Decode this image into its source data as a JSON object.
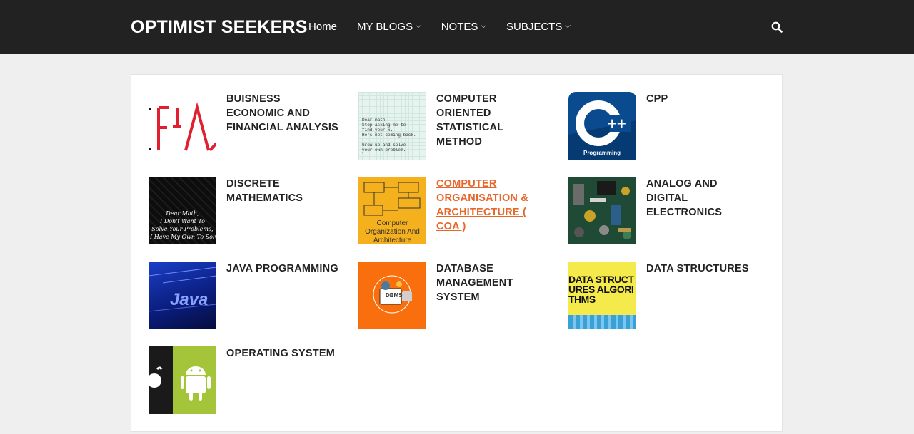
{
  "brand": "OPTIMIST SEEKERS",
  "nav": {
    "home": "Home",
    "blogs": "MY BLOGS",
    "notes": "NOTES",
    "subjects": "SUBJECTS"
  },
  "subjects": [
    {
      "title": "BUISNESS ECONOMIC AND FINANCIAL ANALYSIS",
      "thumb_text": "FA"
    },
    {
      "title": "COMPUTER ORIENTED STATISTICAL METHOD",
      "thumb_text": "Dear math\nStop asking me to\nfind your x.\nHe's not coming back.\n\nGrow up and solve\nyour own problem."
    },
    {
      "title": "CPP",
      "thumb_text": "Programming",
      "thumb_sub": "++"
    },
    {
      "title": "DISCRETE MATHEMATICS",
      "thumb_text": "Dear Math,\nI Don't Want To\nSolve Your Problems,\nI Have My Own To Solve"
    },
    {
      "title": "COMPUTER ORGANISATION & ARCHITECTURE ( COA )",
      "thumb_text": "Computer Organization And Architecture",
      "active": true
    },
    {
      "title": "ANALOG AND DIGITAL ELECTRONICS"
    },
    {
      "title": "JAVA PROGRAMMING",
      "thumb_text": "Java"
    },
    {
      "title": "DATABASE MANAGEMENT SYSTEM",
      "thumb_text": "DBMS"
    },
    {
      "title": "DATA STRUCTURES",
      "thumb_text": "DATA STRUCTURES ALGORITHMS"
    },
    {
      "title": "OPERATING SYSTEM"
    }
  ],
  "colors": {
    "topbar": "#222222",
    "accent": "#e5672a",
    "page_bg": "#efefef"
  }
}
